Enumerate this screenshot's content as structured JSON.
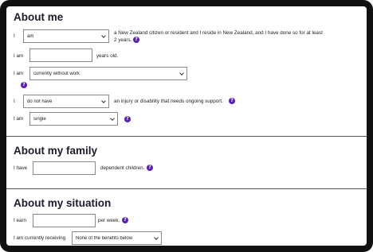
{
  "sections": {
    "about_me": {
      "title": "About me",
      "row1": {
        "prefix": "I",
        "select_value": "am",
        "suffix_line1": "a New Zealand citizen or resident and I reside in New Zealand, and I have done so for at least",
        "suffix_line2": "2 years.",
        "help": "?"
      },
      "row2": {
        "prefix": "I am",
        "input_value": "",
        "suffix": "years old."
      },
      "row3": {
        "prefix": "I am",
        "select_value": "currently without work",
        "help": "?"
      },
      "row4": {
        "prefix": "I",
        "select_value": "do not have",
        "suffix": "an injury or disability that needs ongoing support.",
        "help": "?"
      },
      "row5": {
        "prefix": "I am",
        "select_value": "single",
        "help": "?"
      }
    },
    "about_family": {
      "title": "About my family",
      "row1": {
        "prefix": "I have",
        "input_value": "",
        "suffix": "dependent children.",
        "help": "?"
      }
    },
    "about_situation": {
      "title": "About my situation",
      "row1": {
        "prefix": "I earn",
        "input_value": "",
        "suffix": "per week.",
        "help": "?"
      },
      "row2": {
        "prefix": "I am currently receiving",
        "select_value": "None of the benefits below"
      }
    }
  },
  "colors": {
    "help_icon": "#5a1fb3",
    "frame": "#111111",
    "divider": "#555555"
  },
  "icons": {
    "help": "question-circle-icon",
    "dropdown": "chevron-down-icon"
  }
}
